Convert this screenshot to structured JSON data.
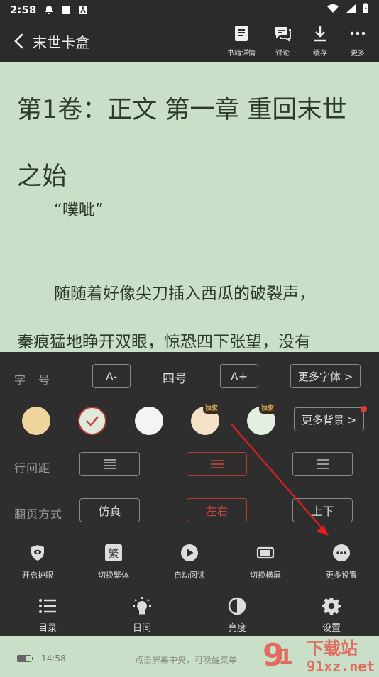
{
  "status_bar": {
    "time": "2:58"
  },
  "top_bar": {
    "title": "末世卡盒",
    "actions": [
      "书籍详情",
      "讨论",
      "缓存",
      "更多"
    ]
  },
  "content": {
    "chapter_title": "第1卷：正文 第一章 重回末世之始",
    "paragraphs": [
      "“噗呲”",
      "随随着好像尖刀插入西瓜的破裂声，",
      "秦痕猛地睁开双眼，惊恐四下张望，没有"
    ]
  },
  "settings": {
    "font_size": {
      "label": "字　号",
      "decrease": "A-",
      "value": "四号",
      "increase": "A+",
      "more": "更多字体 >"
    },
    "background": {
      "badge": "独家",
      "more": "更多背景 >",
      "colors": [
        "#f0d49e",
        "#dfe9dc",
        "#f4f4f4",
        "#f3e2c8",
        "#e3efe1"
      ]
    },
    "line_spacing": {
      "label": "行间距"
    },
    "page_turn": {
      "label": "翻页方式",
      "options": [
        "仿真",
        "左右",
        "上下"
      ]
    },
    "tools": [
      "开启护眼",
      "切换繁体",
      "自动阅读",
      "切换横屏",
      "更多设置"
    ],
    "traditional_glyph": "繁"
  },
  "bottom_nav": [
    "目录",
    "日间",
    "亮度",
    "设置"
  ],
  "footer": {
    "time": "14:58",
    "hint": "点击屏幕中央，可唤醒菜单",
    "battery_level": 0.6
  },
  "watermark": {
    "text": "91xz.net",
    "brand": "下载站"
  },
  "colors": {
    "accent": "#b93a35",
    "panel": "#2e2e2e",
    "page": "#c9dfc7"
  }
}
